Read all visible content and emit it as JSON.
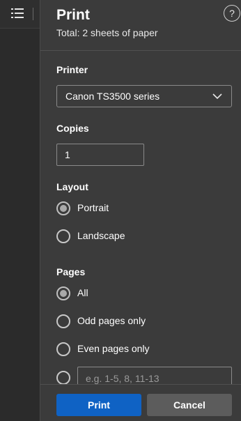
{
  "panel": {
    "title": "Print",
    "subtitle": "Total: 2 sheets of paper",
    "help_label": "?"
  },
  "printer": {
    "label": "Printer",
    "selected": "Canon TS3500 series"
  },
  "copies": {
    "label": "Copies",
    "value": "1"
  },
  "layout": {
    "label": "Layout",
    "options": [
      {
        "label": "Portrait",
        "checked": true
      },
      {
        "label": "Landscape",
        "checked": false
      }
    ]
  },
  "pages": {
    "label": "Pages",
    "options": [
      {
        "label": "All",
        "checked": true
      },
      {
        "label": "Odd pages only",
        "checked": false
      },
      {
        "label": "Even pages only",
        "checked": false
      }
    ],
    "custom_placeholder": "e.g. 1-5, 8, 11-13"
  },
  "footer": {
    "print_label": "Print",
    "cancel_label": "Cancel"
  },
  "colors": {
    "accent": "#0f62c4",
    "panel_bg": "#3b3b3b",
    "secondary_button": "#5c5c5c"
  },
  "icons": {
    "toolbar": "table-of-contents-icon",
    "dropdown": "chevron-down-icon",
    "help": "help-icon"
  }
}
